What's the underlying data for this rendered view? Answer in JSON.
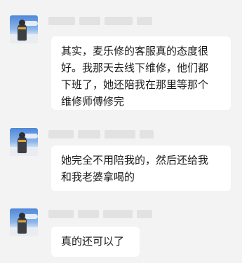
{
  "messages": [
    {
      "text": "其实，麦乐修的客服真的态度很\n好。我那天去线下维修，他们都\n下班了，她还陪我在那里等那个\n维修师傅修完"
    },
    {
      "text": "她完全不用陪我的，然后还给我\n和我老婆拿喝的"
    },
    {
      "text": "真的还可以了"
    }
  ]
}
